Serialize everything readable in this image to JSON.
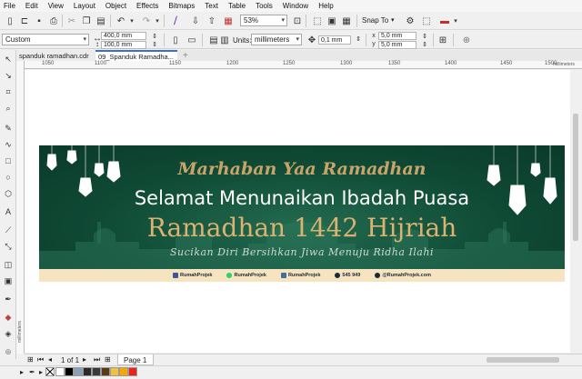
{
  "menu": [
    "File",
    "Edit",
    "View",
    "Layout",
    "Object",
    "Effects",
    "Bitmaps",
    "Text",
    "Table",
    "Tools",
    "Window",
    "Help"
  ],
  "toolbar": {
    "zoom": "53%",
    "snap_to": "Snap To"
  },
  "property_bar": {
    "preset": "Custom",
    "width": "400,0 mm",
    "height": "100,0 mm",
    "units_label": "Units:",
    "units": "millimeters",
    "nudge": "0,1 mm",
    "dup_x": "5,0 mm",
    "dup_y": "5,0 mm"
  },
  "doc_tabs": [
    "spanduk ramadhan.cdr",
    "09_Spanduk Ramadha..."
  ],
  "ruler": {
    "ticks": [
      "1050",
      "1100",
      "1150",
      "1200",
      "1250",
      "1300",
      "1350",
      "1400",
      "1450",
      "1500"
    ],
    "unit": "millimeters",
    "vertical_unit": "millimeters"
  },
  "banner": {
    "line1": "Marhaban Yaa Ramadhan",
    "line2": "Selamat Menunaikan Ibadah Puasa",
    "line3": "Ramadhan 1442 Hijriah",
    "line4": "Sucikan Diri Bersihkan Jiwa Menuju Ridha Ilahi",
    "footer": [
      {
        "icon": "facebook-icon",
        "text": "RumahProjek",
        "color": "#3b5998"
      },
      {
        "icon": "whatsapp-icon",
        "text": "RumahProjek",
        "color": "#25d366"
      },
      {
        "icon": "instagram-icon",
        "text": "RumahProjek",
        "color": "#3f729b"
      },
      {
        "icon": "phone-icon",
        "text": "545 949",
        "color": "#1c2a38"
      },
      {
        "icon": "globe-icon",
        "text": "@RumahProjek.com",
        "color": "#1c2a38"
      }
    ]
  },
  "page_nav": {
    "counter": "1 of 1",
    "page_tab": "Page 1"
  },
  "palette": [
    "#ffffff",
    "#000000",
    "#8aa0b5",
    "#2a2a2a",
    "#3a3a3a",
    "#5a3a1a",
    "#f0c040",
    "#f6a800",
    "#e8251d"
  ]
}
